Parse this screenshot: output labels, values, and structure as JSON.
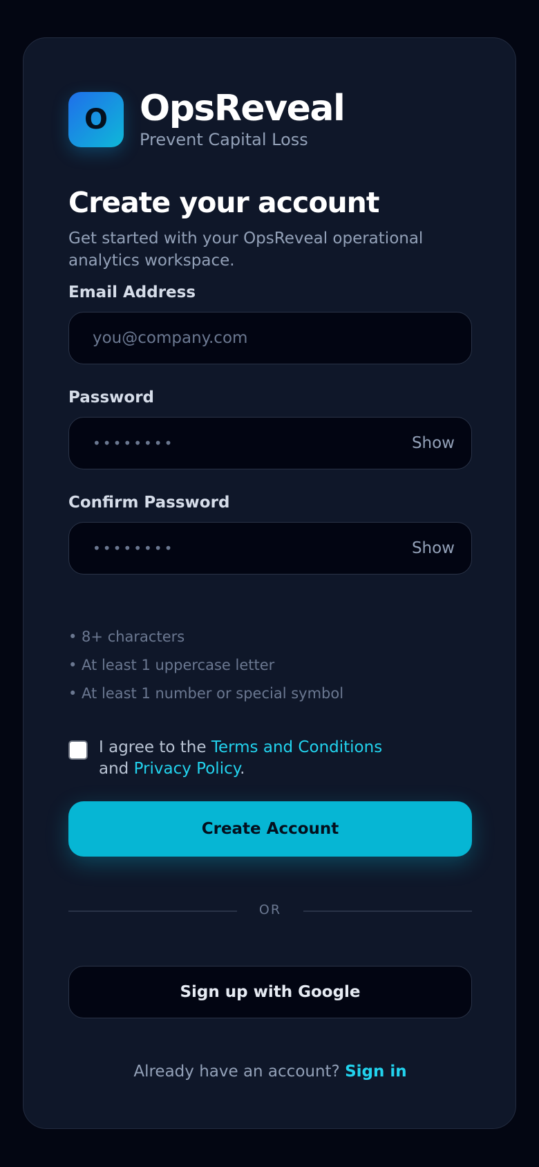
{
  "brand": {
    "logo_letter": "O",
    "name": "OpsReveal",
    "tagline": "Prevent Capital Loss"
  },
  "heading": "Create your account",
  "subheading": "Get started with your OpsReveal operational analytics workspace.",
  "form": {
    "email": {
      "label": "Email Address",
      "placeholder": "you@company.com",
      "value": ""
    },
    "password": {
      "label": "Password",
      "masked_value": "••••••••",
      "show_label": "Show"
    },
    "confirm_password": {
      "label": "Confirm Password",
      "masked_value": "••••••••",
      "show_label": "Show"
    },
    "requirements": [
      "• 8+ characters",
      "• At least 1 uppercase letter",
      "• At least 1 number or special symbol"
    ],
    "agree": {
      "checked": false,
      "prefix": "I agree to the ",
      "terms_link": "Terms and Conditions",
      "middle": " and ",
      "privacy_link": "Privacy Policy",
      "suffix": "."
    },
    "submit_label": "Create Account"
  },
  "divider_label": "OR",
  "google_label": "Sign up with Google",
  "footer": {
    "prompt": "Already have an account? ",
    "signin_link": "Sign in"
  },
  "colors": {
    "background": "#030612",
    "card": "#0f1729",
    "accent": "#06b6d4",
    "link": "#22d3ee"
  }
}
